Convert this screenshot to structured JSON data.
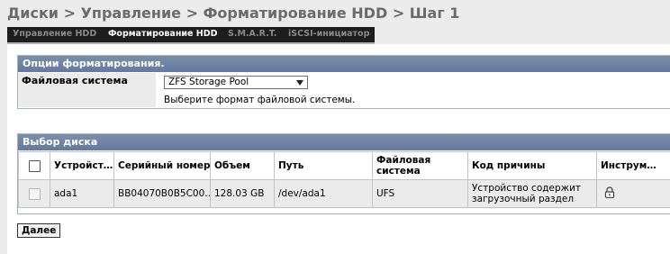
{
  "breadcrumb": "Диски > Управление > Форматирование HDD > Шаг 1",
  "tabs": [
    {
      "label": "Управление HDD",
      "active": false
    },
    {
      "label": "Форматирование HDD",
      "active": true
    },
    {
      "label": "S.M.A.R.T.",
      "active": false
    },
    {
      "label": "iSCSI-инициатор",
      "active": false
    }
  ],
  "format_options": {
    "header": "Опции форматирования.",
    "filesystem_label": "Файловая система",
    "filesystem_value": "ZFS Storage Pool",
    "filesystem_hint": "Выберите формат файловой системы."
  },
  "disk_select": {
    "header": "Выбор диска",
    "columns": [
      "Устройст…",
      "Серийный номер",
      "Объем",
      "Путь",
      "Файловая система",
      "Код причины",
      "Инструм…"
    ],
    "rows": [
      {
        "device": "ada1",
        "serial": "BB04070B0B5C00…",
        "size": "128.03 GB",
        "path": "/dev/ada1",
        "filesystem": "UFS",
        "reason": "Устройство содержит загрузочный раздел",
        "tool_icon": "lock-icon"
      }
    ]
  },
  "next_button": "Далее"
}
